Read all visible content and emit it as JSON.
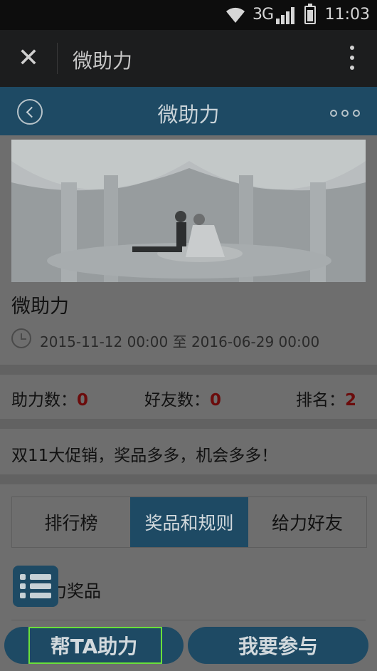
{
  "status_bar": {
    "network": "3G",
    "time": "11:03"
  },
  "wechat_bar": {
    "close_icon": "close-icon",
    "title": "微助力",
    "more_icon": "more-vertical-icon"
  },
  "header": {
    "title": "微助力",
    "back_icon": "back-circle-icon",
    "more_icon": "more-horizontal-icon",
    "color": "#1e4a64"
  },
  "event": {
    "title": "微助力",
    "start": "2015-11-12 00:00",
    "separator": "至",
    "end": "2016-06-29 00:00"
  },
  "stats": {
    "help_label": "助力数：",
    "help_value": "0",
    "friends_label": "好友数：",
    "friends_value": "0",
    "rank_label": "排名：",
    "rank_value": "2"
  },
  "promo_text": "双11大促销，奖品多多，机会多多！",
  "tabs": [
    {
      "label": "排行榜",
      "active": false
    },
    {
      "label": "奖品和规则",
      "active": true
    },
    {
      "label": "给力好友",
      "active": false
    }
  ],
  "section_title": "力奖品",
  "buttons": {
    "help": "帮TA助力",
    "join": "我要参与"
  }
}
